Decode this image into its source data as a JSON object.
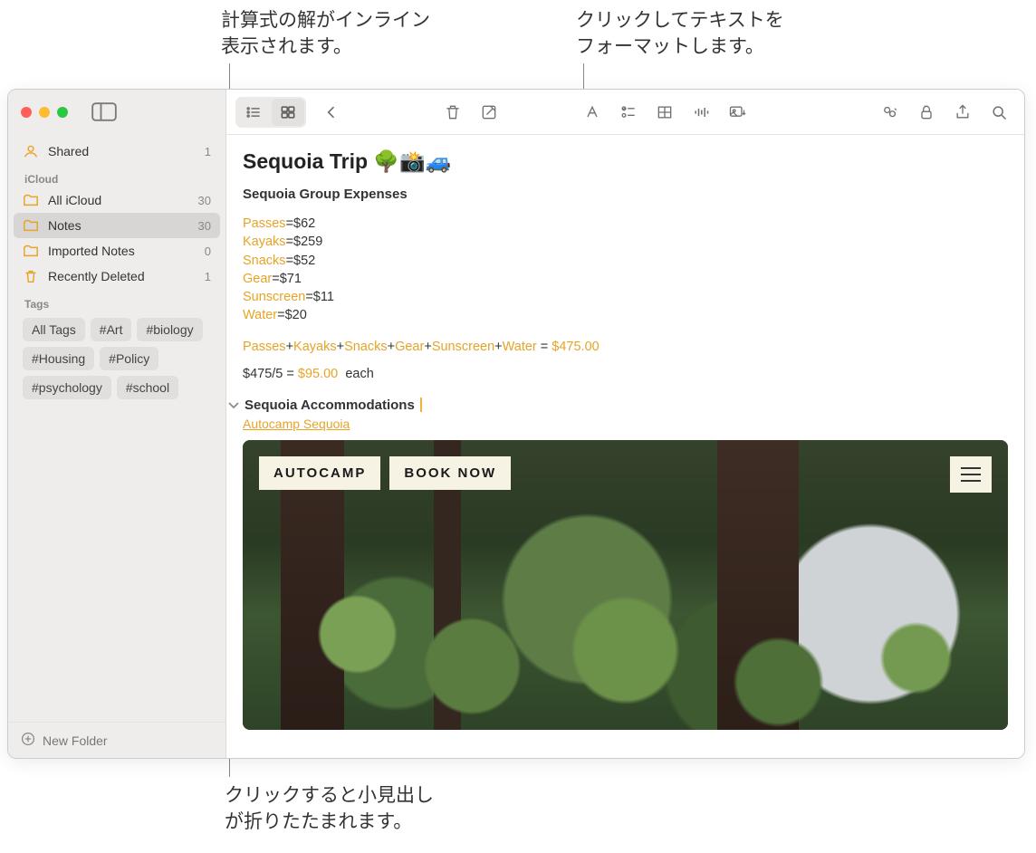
{
  "callouts": {
    "top_left": "計算式の解がインライン\n表示されます。",
    "top_right": "クリックしてテキストを\nフォーマットします。",
    "bottom": "クリックすると小見出し\nが折りたたまれます。"
  },
  "sidebar": {
    "shared": {
      "label": "Shared",
      "count": "1"
    },
    "group": "iCloud",
    "items": [
      {
        "label": "All iCloud",
        "count": "30"
      },
      {
        "label": "Notes",
        "count": "30"
      },
      {
        "label": "Imported Notes",
        "count": "0"
      },
      {
        "label": "Recently Deleted",
        "count": "1"
      }
    ],
    "tags_header": "Tags",
    "tags": [
      "All Tags",
      "#Art",
      "#biology",
      "#Housing",
      "#Policy",
      "#psychology",
      "#school"
    ],
    "new_folder": "New Folder"
  },
  "note": {
    "title": "Sequoia Trip 🌳📸🚙",
    "subtitle": "Sequoia Group Expenses",
    "expenses": [
      {
        "name": "Passes",
        "value": "$62"
      },
      {
        "name": "Kayaks",
        "value": "$259"
      },
      {
        "name": "Snacks",
        "value": "$52"
      },
      {
        "name": "Gear",
        "value": "$71"
      },
      {
        "name": "Sunscreen",
        "value": "$11"
      },
      {
        "name": "Water",
        "value": "$20"
      }
    ],
    "sum_expr_parts": [
      "Passes",
      "Kayaks",
      "Snacks",
      "Gear",
      "Sunscreen",
      "Water"
    ],
    "sum_value": "$475.00",
    "division_lhs": "$475/5 =",
    "division_result": "$95.00",
    "division_suffix": "each",
    "section_heading": "Sequoia Accommodations",
    "link_text": "Autocamp Sequoia",
    "embed": {
      "logo": "AUTOCAMP",
      "cta": "BOOK NOW"
    }
  }
}
